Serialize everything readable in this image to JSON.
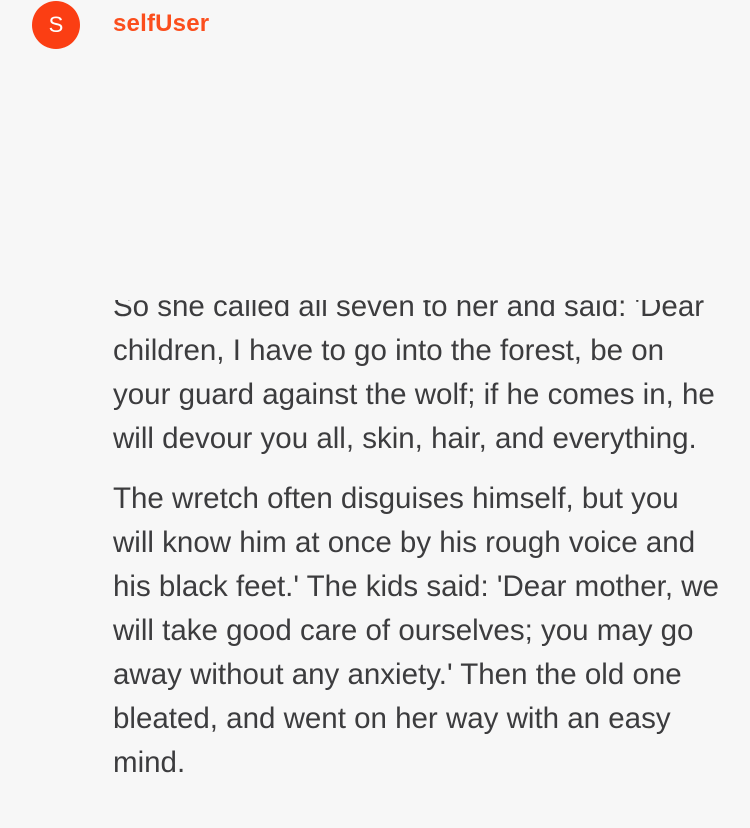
{
  "message": {
    "avatar_initial": "S",
    "sender_name": "selfUser",
    "paragraphs": [
      "So she called all seven to her and said: 'Dear children, I have to go into the forest, be on your guard against the wolf; if he comes in, he will devour you all, skin, hair, and everything.",
      "The wretch often disguises himself, but you will know him at once by his rough voice and his black feet.' The kids said: 'Dear mother, we will take good care of ourselves; you may go away without any anxiety.' Then the old one bleated, and went on her way with an easy mind."
    ]
  },
  "colors": {
    "accent": "#fb3e13",
    "sender_name": "#fb4e1d",
    "background": "#f7f7f7",
    "text": "#3c3c3e"
  }
}
